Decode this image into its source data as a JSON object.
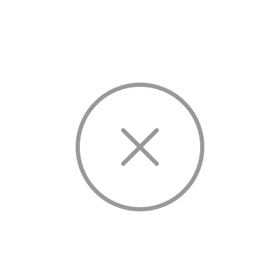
{
  "close_button": {
    "icon": "close-circle-icon",
    "glyph_icon": "close-icon",
    "stroke_color": "#999999",
    "background_color": "#ffffff"
  }
}
